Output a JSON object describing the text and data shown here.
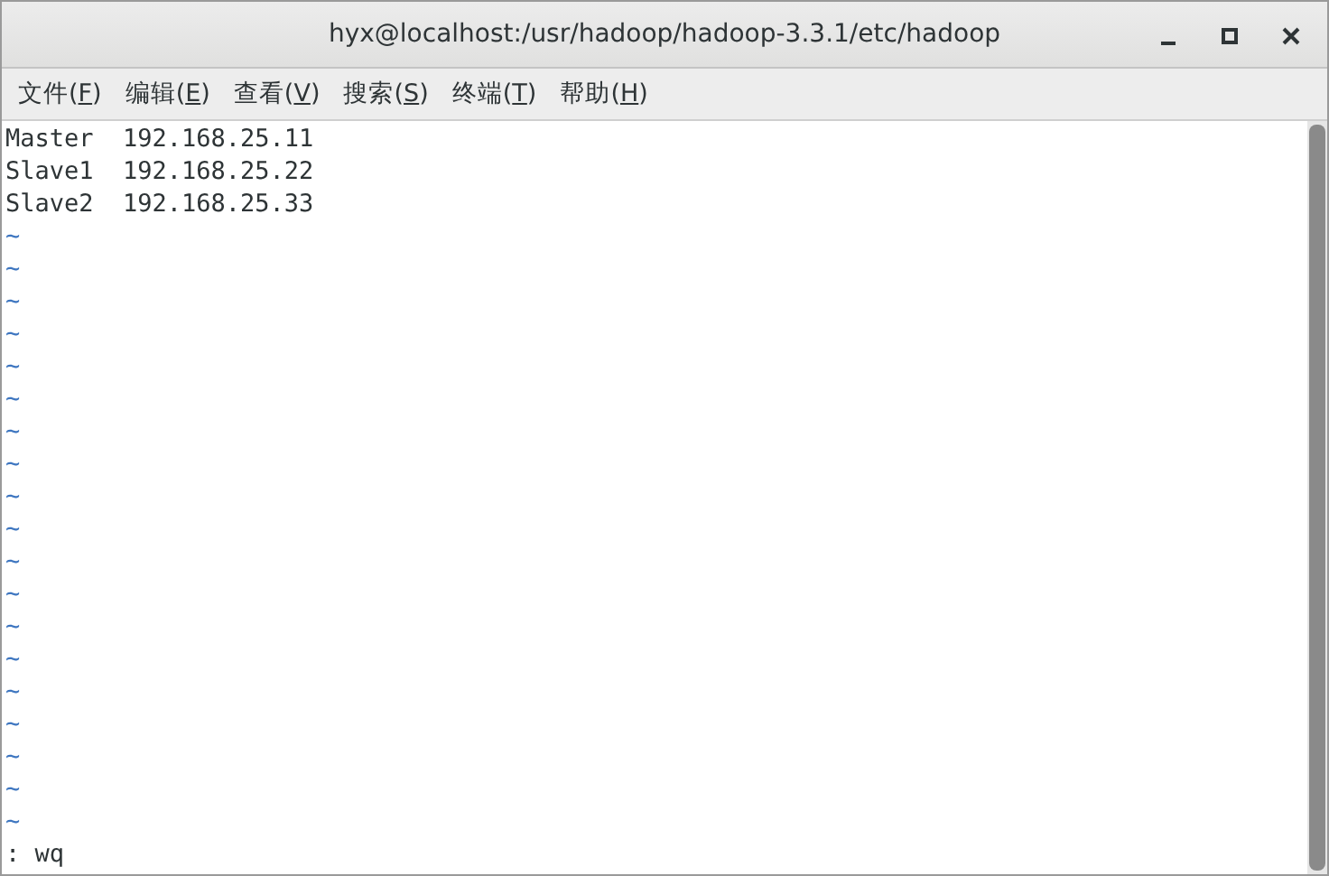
{
  "window": {
    "title": "hyx@localhost:/usr/hadoop/hadoop-3.3.1/etc/hadoop"
  },
  "menu": [
    {
      "before": "文件(",
      "key": "F",
      "after": ")"
    },
    {
      "before": "编辑(",
      "key": "E",
      "after": ")"
    },
    {
      "before": "查看(",
      "key": "V",
      "after": ")"
    },
    {
      "before": "搜索(",
      "key": "S",
      "after": ")"
    },
    {
      "before": "终端(",
      "key": "T",
      "after": ")"
    },
    {
      "before": "帮助(",
      "key": "H",
      "after": ")"
    }
  ],
  "lines": [
    {
      "kind": "text",
      "text": "Master  192.168.25.11"
    },
    {
      "kind": "text",
      "text": "Slave1  192.168.25.22"
    },
    {
      "kind": "text",
      "text": "Slave2  192.168.25.33"
    },
    {
      "kind": "empty",
      "text": "~"
    },
    {
      "kind": "empty",
      "text": "~"
    },
    {
      "kind": "empty",
      "text": "~"
    },
    {
      "kind": "empty",
      "text": "~"
    },
    {
      "kind": "empty",
      "text": "~"
    },
    {
      "kind": "empty",
      "text": "~"
    },
    {
      "kind": "empty",
      "text": "~"
    },
    {
      "kind": "empty",
      "text": "~"
    },
    {
      "kind": "empty",
      "text": "~"
    },
    {
      "kind": "empty",
      "text": "~"
    },
    {
      "kind": "empty",
      "text": "~"
    },
    {
      "kind": "empty",
      "text": "~"
    },
    {
      "kind": "empty",
      "text": "~"
    },
    {
      "kind": "empty",
      "text": "~"
    },
    {
      "kind": "empty",
      "text": "~"
    },
    {
      "kind": "empty",
      "text": "~"
    },
    {
      "kind": "empty",
      "text": "~"
    },
    {
      "kind": "empty",
      "text": "~"
    },
    {
      "kind": "empty",
      "text": "~"
    }
  ],
  "command_line": ": wq"
}
